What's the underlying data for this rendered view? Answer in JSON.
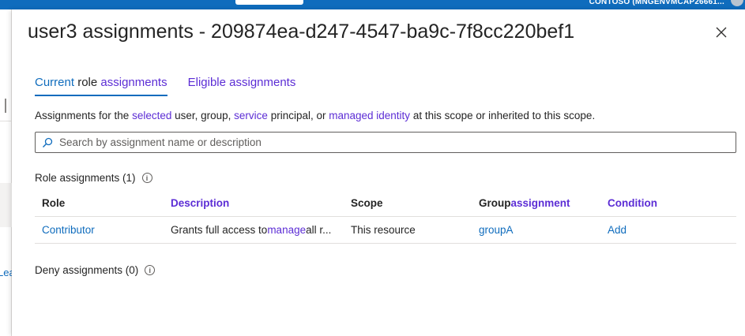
{
  "topbar": {
    "tenant": "CONTOSO (MNGENVMCAP26661..."
  },
  "left_peek": "Lea",
  "panel": {
    "title": "user3 assignments - 209874ea-d247-4547-ba9c-7f8cc220bef1",
    "tabs": {
      "current": {
        "part1": "Current",
        "part2": " role ",
        "part3": "assignments"
      },
      "eligible": "Eligible assignments"
    },
    "description": {
      "t1": "Assignments for the ",
      "l1": "selected",
      "t2": " user, group, ",
      "l2": "service",
      "t3": " principal, or ",
      "l3": "managed identity",
      "t4": " at this scope or inherited to this scope."
    },
    "search": {
      "placeholder": "Search by assignment name or description",
      "value": ""
    },
    "role_assignments": {
      "label": "Role assignments (1)"
    },
    "deny_assignments": {
      "label": "Deny assignments (0)"
    },
    "table": {
      "headers": {
        "role": "Role",
        "description": "Description",
        "scope": "Scope",
        "group_part1": "Group ",
        "group_part2": "assignment",
        "condition": "Condition"
      },
      "rows": [
        {
          "role": "Contributor",
          "desc_part1": "Grants full access to ",
          "desc_part2": "manage",
          "desc_part3": " all r...",
          "scope": "This resource",
          "group": "groupA",
          "condition": "Add"
        }
      ]
    }
  },
  "colors": {
    "accent": "#0f6cbd",
    "link_purple": "#5c2dd5",
    "text": "#242424"
  },
  "icons": {
    "close": "close-icon",
    "search": "search-icon",
    "info": "info-icon"
  }
}
